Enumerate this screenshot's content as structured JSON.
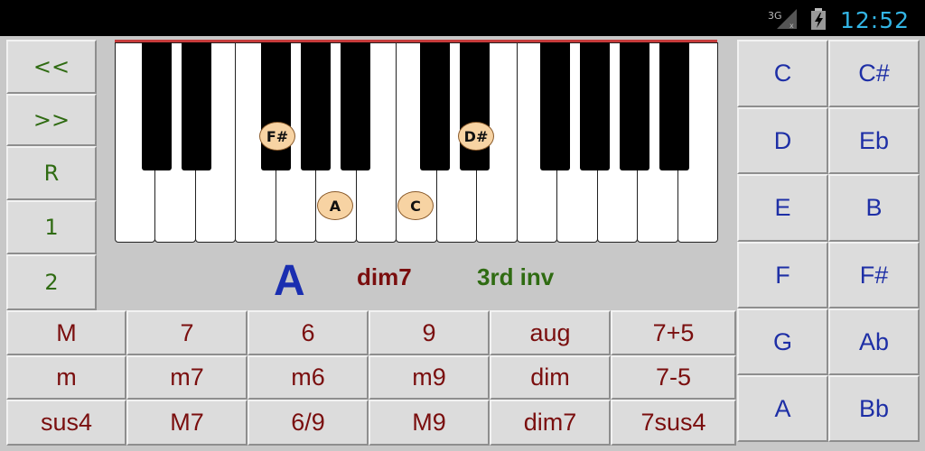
{
  "status_bar": {
    "network_label": "3G",
    "network_icon": "signal-3g-icon",
    "battery_icon": "battery-charging-icon",
    "time": "12:52"
  },
  "colors": {
    "nav_text": "#2f6b12",
    "chord_text": "#7a0e0e",
    "root_text": "#1e2fa6",
    "marker_fill": "#f7d3a3",
    "clock": "#33b5e5"
  },
  "nav_buttons": [
    "<<",
    ">>",
    "R",
    "1",
    "2"
  ],
  "keyboard": {
    "markers": [
      "F#",
      "A",
      "C",
      "D#"
    ]
  },
  "display": {
    "root": "A",
    "chord": "dim7",
    "inversion": "3rd inv"
  },
  "chord_types": [
    [
      "M",
      "7",
      "6",
      "9",
      "aug",
      "7+5"
    ],
    [
      "m",
      "m7",
      "m6",
      "m9",
      "dim",
      "7-5"
    ],
    [
      "sus4",
      "M7",
      "6/9",
      "M9",
      "dim7",
      "7sus4"
    ]
  ],
  "roots": [
    [
      "C",
      "C#"
    ],
    [
      "D",
      "Eb"
    ],
    [
      "E",
      "B"
    ],
    [
      "F",
      "F#"
    ],
    [
      "G",
      "Ab"
    ],
    [
      "A",
      "Bb"
    ]
  ]
}
